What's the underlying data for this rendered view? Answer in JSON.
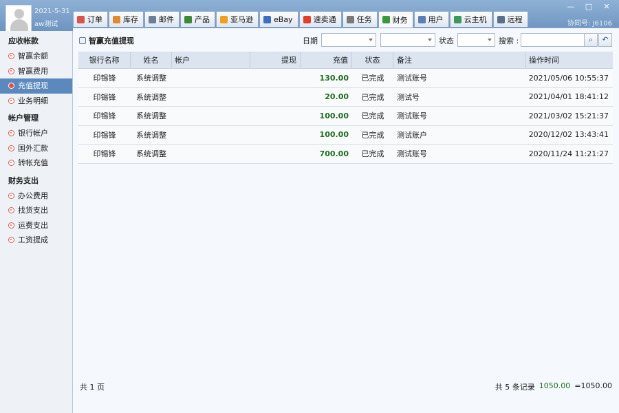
{
  "user": {
    "date": "2021-5-31",
    "name": "aw测试"
  },
  "window": {
    "controls": [
      "—",
      "□",
      "✕"
    ],
    "agent_no": "协同号: J6106"
  },
  "tabs": [
    {
      "label": "订单",
      "icon": "order-icon",
      "color": "#d9534f"
    },
    {
      "label": "库存",
      "icon": "inventory-icon",
      "color": "#e08a2b"
    },
    {
      "label": "邮件",
      "icon": "mail-icon",
      "color": "#6b7f96"
    },
    {
      "label": "产品",
      "icon": "product-icon",
      "color": "#3a8a3a"
    },
    {
      "label": "亚马逊",
      "icon": "amazon-icon",
      "color": "#f0a020"
    },
    {
      "label": "eBay",
      "icon": "ebay-icon",
      "color": "#3c6fbf"
    },
    {
      "label": "速卖通",
      "icon": "aliexpress-icon",
      "color": "#e0402a"
    },
    {
      "label": "任务",
      "icon": "task-icon",
      "color": "#7a7a7a"
    },
    {
      "label": "财务",
      "icon": "finance-icon",
      "color": "#3a9a3a"
    },
    {
      "label": "用户",
      "icon": "user-icon",
      "color": "#5a7fb0"
    },
    {
      "label": "云主机",
      "icon": "cloud-host-icon",
      "color": "#3a9a5a"
    },
    {
      "label": "远程",
      "icon": "remote-icon",
      "color": "#5a6f8a"
    }
  ],
  "active_tab": "财务",
  "sidebar": {
    "sections": [
      {
        "title": "应收帐款",
        "items": [
          "智赢余额",
          "智赢费用",
          "充值提现",
          "业务明细"
        ]
      },
      {
        "title": "帐户管理",
        "items": [
          "银行帐户",
          "国外汇款",
          "转帐充值"
        ]
      },
      {
        "title": "财务支出",
        "items": [
          "办公费用",
          "找货支出",
          "运费支出",
          "工资提成"
        ]
      }
    ],
    "active_item": "充值提现"
  },
  "toolbar": {
    "title": "智赢充值提现",
    "date_label": "日期",
    "status_label": "状态",
    "search_label": "搜索 :",
    "search_value": "",
    "date_from": "",
    "date_to": "",
    "status_value": ""
  },
  "table": {
    "columns": [
      "银行名称",
      "姓名",
      "帐户",
      "提现",
      "充值",
      "状态",
      "备注",
      "操作时间"
    ],
    "rows": [
      {
        "bank": "印锡锋",
        "name": "系统调整",
        "account": "",
        "withdraw": "",
        "charge": "130.00",
        "status": "已完成",
        "note": "测试账号",
        "time": "2021/05/06 10:55:37"
      },
      {
        "bank": "印锡锋",
        "name": "系统调整",
        "account": "",
        "withdraw": "",
        "charge": "20.00",
        "status": "已完成",
        "note": "测试号",
        "time": "2021/04/01 18:41:12"
      },
      {
        "bank": "印锡锋",
        "name": "系统调整",
        "account": "",
        "withdraw": "",
        "charge": "100.00",
        "status": "已完成",
        "note": "测试账号",
        "time": "2021/03/02 15:21:37"
      },
      {
        "bank": "印锡锋",
        "name": "系统调整",
        "account": "",
        "withdraw": "",
        "charge": "100.00",
        "status": "已完成",
        "note": "测试账户",
        "time": "2020/12/02 13:43:41"
      },
      {
        "bank": "印锡锋",
        "name": "系统调整",
        "account": "",
        "withdraw": "",
        "charge": "700.00",
        "status": "已完成",
        "note": "测试账号",
        "time": "2020/11/24 11:21:27"
      }
    ]
  },
  "footer": {
    "pages": "共 1 页",
    "records": "共 5 条记录",
    "total_green": "1050.00",
    "total": "=1050.00"
  },
  "colors": {
    "accent": "#5b89bd",
    "amount": "#1f6d1f"
  }
}
